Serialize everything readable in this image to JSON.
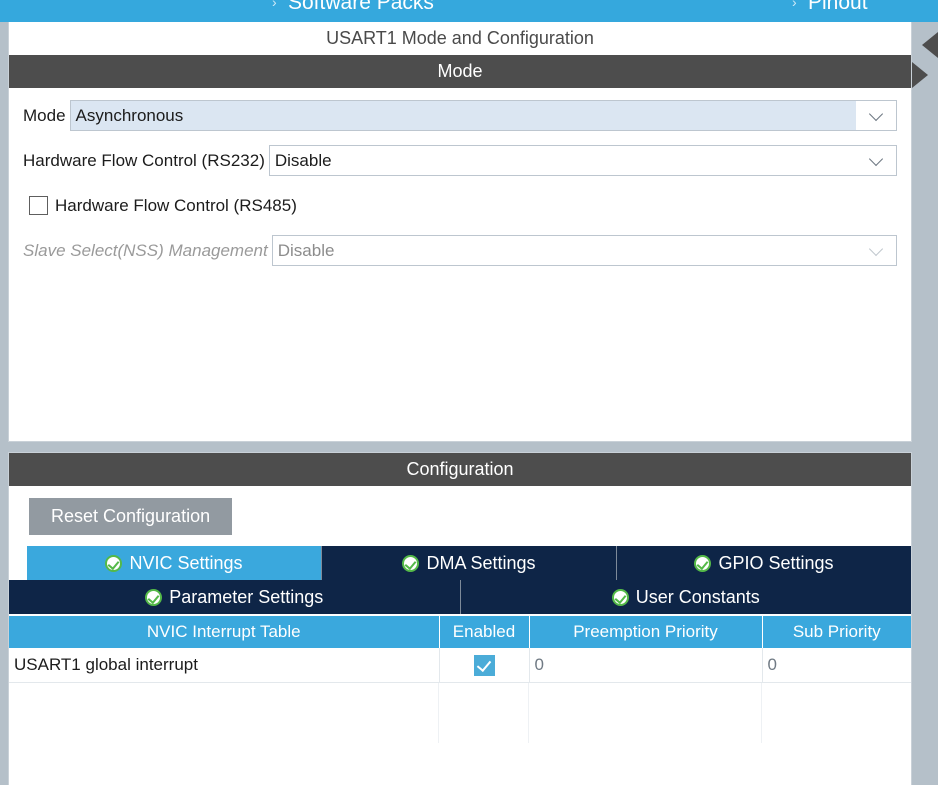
{
  "topbar": {
    "tabs": [
      {
        "label": "Software Packs",
        "icon": "chevron-right-icon"
      },
      {
        "label": "Pinout",
        "icon": "chevron-right-icon"
      }
    ],
    "accent_color": "#35a8dd"
  },
  "page_title": "USART1 Mode and Configuration",
  "mode_panel": {
    "header": "Mode",
    "rows": [
      {
        "kind": "combo",
        "label": "Mode",
        "value": "Asynchronous",
        "state": "selected",
        "name": "mode-select"
      },
      {
        "kind": "combo",
        "label": "Hardware Flow Control (RS232)",
        "value": "Disable",
        "state": "normal",
        "name": "hardware-flow-control-rs232-select"
      },
      {
        "kind": "checkbox",
        "label": "Hardware Flow Control (RS485)",
        "checked": false,
        "name": "hardware-flow-control-rs485-checkbox"
      },
      {
        "kind": "combo",
        "label": "Slave Select(NSS) Management",
        "value": "Disable",
        "state": "disabled",
        "name": "slave-select-nss-management-select"
      }
    ]
  },
  "config_panel": {
    "header": "Configuration",
    "reset_button": "Reset Configuration",
    "tabs_row1": [
      {
        "label": "NVIC Settings",
        "active": true,
        "icon": "green-check-icon"
      },
      {
        "label": "DMA Settings",
        "active": false,
        "icon": "green-check-icon"
      },
      {
        "label": "GPIO Settings",
        "active": false,
        "icon": "green-check-icon"
      }
    ],
    "tabs_row2": [
      {
        "label": "Parameter Settings",
        "active": false,
        "icon": "green-check-icon"
      },
      {
        "label": "User Constants",
        "active": false,
        "icon": "green-check-icon"
      }
    ],
    "table": {
      "columns": [
        "NVIC Interrupt Table",
        "Enabled",
        "Preemption Priority",
        "Sub Priority"
      ],
      "rows": [
        {
          "interrupt": "USART1 global interrupt",
          "enabled": true,
          "preemption_priority": "0",
          "sub_priority": "0"
        }
      ]
    }
  },
  "rail": {
    "collapse_left_icon": "triangle-left-icon",
    "collapse_right_icon": "triangle-right-icon"
  },
  "colors": {
    "accent_blue": "#3aa8dd",
    "tab_navy": "#0e2547",
    "header_gray": "#4d4d4d",
    "panel_gap": "#b5c0c9",
    "check_green": "#54b948",
    "selected_combo": "#dbe6f2"
  }
}
